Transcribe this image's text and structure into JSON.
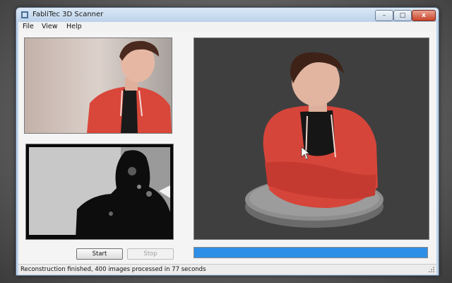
{
  "window": {
    "title": "FabliTec 3D Scanner",
    "controls": {
      "minimize": "–",
      "maximize": "□",
      "close": "x"
    }
  },
  "menu": [
    {
      "label": "File"
    },
    {
      "label": "View"
    },
    {
      "label": "Help"
    }
  ],
  "buttons": {
    "start": "Start",
    "stop": "Stop"
  },
  "progress": {
    "fraction": 1.0
  },
  "status": {
    "text": "Reconstruction finished, 400 images processed in 77 seconds"
  },
  "colors": {
    "accent": "#2e8fe6",
    "jacket": "#d9473a",
    "viewport_bg": "#3f3f3f"
  }
}
